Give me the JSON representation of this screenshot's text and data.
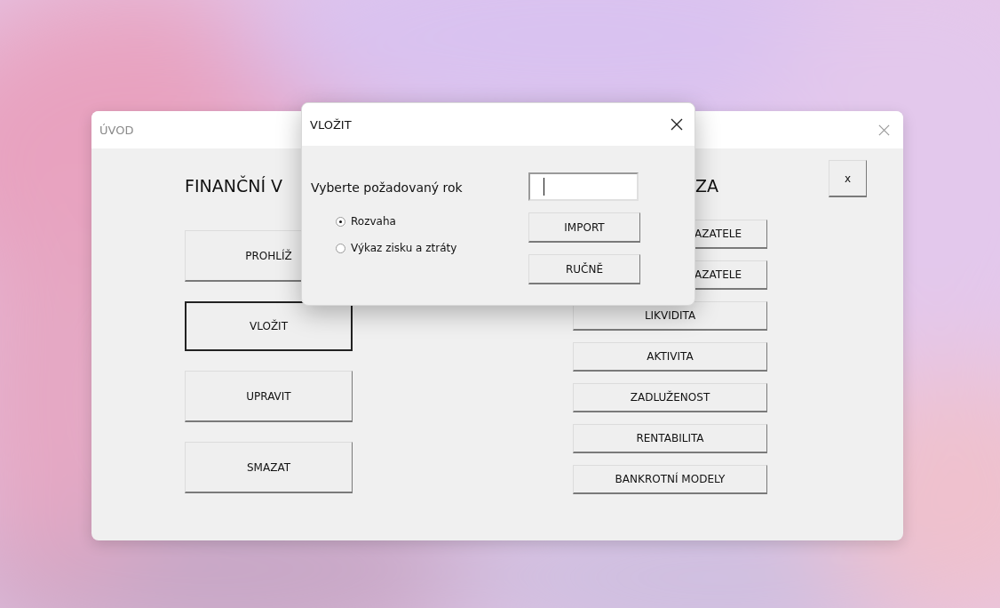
{
  "main_window": {
    "title": "ÚVOD",
    "heading_left": "FINANČNÍ V",
    "heading_right": "ZA",
    "x_button": "x",
    "left_buttons": [
      {
        "label": "PROHLÍŽ",
        "focused": false
      },
      {
        "label": "VLOŽIT",
        "focused": true
      },
      {
        "label": "UPRAVIT",
        "focused": false
      },
      {
        "label": "SMAZAT",
        "focused": false
      }
    ],
    "right_buttons": [
      {
        "label": "AZATELE",
        "kind": "cut"
      },
      {
        "label": "AZATELE",
        "kind": "cut"
      },
      {
        "label": "LIKVIDITA",
        "kind": "full"
      },
      {
        "label": "AKTIVITA",
        "kind": "full"
      },
      {
        "label": "ZADLUŽENOST",
        "kind": "full"
      },
      {
        "label": "RENTABILITA",
        "kind": "full"
      },
      {
        "label": "BANKROTNÍ MODELY",
        "kind": "full"
      }
    ]
  },
  "dialog": {
    "title": "VLOŽIT",
    "prompt": "Vyberte požadovaný rok",
    "options": [
      {
        "label": "Rozvaha",
        "selected": true
      },
      {
        "label": "Výkaz zisku a ztráty",
        "selected": false
      }
    ],
    "buttons": [
      "IMPORT",
      "RUČNĚ"
    ]
  }
}
